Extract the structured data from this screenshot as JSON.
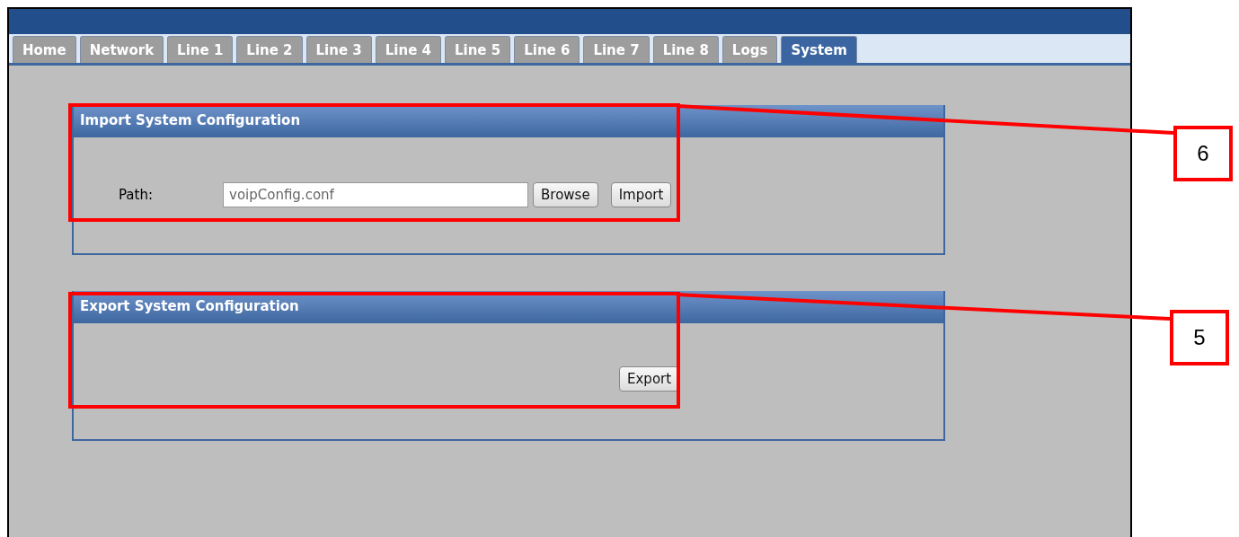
{
  "tabs": [
    {
      "label": "Home",
      "selected": false
    },
    {
      "label": "Network",
      "selected": false
    },
    {
      "label": "Line 1",
      "selected": false
    },
    {
      "label": "Line 2",
      "selected": false
    },
    {
      "label": "Line 3",
      "selected": false
    },
    {
      "label": "Line 4",
      "selected": false
    },
    {
      "label": "Line 5",
      "selected": false
    },
    {
      "label": "Line 6",
      "selected": false
    },
    {
      "label": "Line 7",
      "selected": false
    },
    {
      "label": "Line 8",
      "selected": false
    },
    {
      "label": "Logs",
      "selected": false
    },
    {
      "label": "System",
      "selected": true
    }
  ],
  "panels": [
    {
      "kind": "import",
      "title": "Import System Configuration",
      "path_label": "Path:",
      "path_value": "voipConfig.conf",
      "buttons": [
        "Browse",
        "Import"
      ]
    },
    {
      "kind": "export",
      "title": "Export System Configuration",
      "buttons": [
        "Export"
      ]
    }
  ],
  "callouts": [
    {
      "label": "6"
    },
    {
      "label": "5"
    }
  ]
}
